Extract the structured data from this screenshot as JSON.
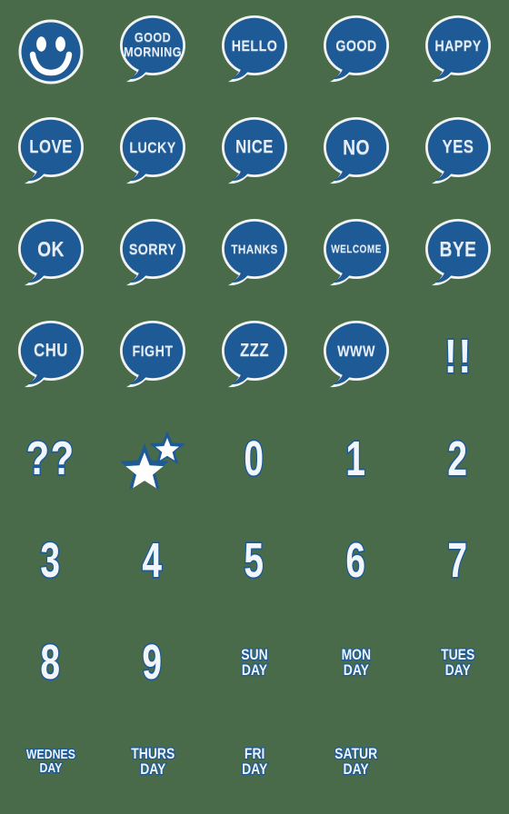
{
  "sheet": {
    "title": "Emoji Sticker Sheet",
    "background_color": "#4a6b4a",
    "bubble_color": "#1d5a96",
    "text_color": "#e8eef5",
    "outline_color": "#1d5a96",
    "columns": 5,
    "rows": 8
  },
  "items": [
    {
      "id": "smiley",
      "kind": "smiley",
      "label": "",
      "name": "sticker-smiley-face",
      "row": 0,
      "col": 0
    },
    {
      "id": "goodmorning",
      "kind": "bubble",
      "label": "GOOD\nMORNING",
      "name": "sticker-good-morning",
      "row": 0,
      "col": 1,
      "size": "sz-two"
    },
    {
      "id": "hello",
      "kind": "bubble",
      "label": "HELLO",
      "name": "sticker-hello",
      "row": 0,
      "col": 2,
      "size": "sz-md"
    },
    {
      "id": "good",
      "kind": "bubble",
      "label": "GOOD",
      "name": "sticker-good",
      "row": 0,
      "col": 3,
      "size": "sz-md"
    },
    {
      "id": "happy",
      "kind": "bubble",
      "label": "HAPPY",
      "name": "sticker-happy",
      "row": 0,
      "col": 4,
      "size": "sz-md"
    },
    {
      "id": "love",
      "kind": "bubble",
      "label": "LOVE",
      "name": "sticker-love",
      "row": 1,
      "col": 0,
      "size": "sz-lg"
    },
    {
      "id": "lucky",
      "kind": "bubble",
      "label": "LUCKY",
      "name": "sticker-lucky",
      "row": 1,
      "col": 1,
      "size": "sz-md"
    },
    {
      "id": "nice",
      "kind": "bubble",
      "label": "NICE",
      "name": "sticker-nice",
      "row": 1,
      "col": 2,
      "size": "sz-lg"
    },
    {
      "id": "no",
      "kind": "bubble",
      "label": "NO",
      "name": "sticker-no",
      "row": 1,
      "col": 3,
      "size": "sz-xl"
    },
    {
      "id": "yes",
      "kind": "bubble",
      "label": "YES",
      "name": "sticker-yes",
      "row": 1,
      "col": 4,
      "size": "sz-lg"
    },
    {
      "id": "ok",
      "kind": "bubble",
      "label": "OK",
      "name": "sticker-ok",
      "row": 2,
      "col": 0,
      "size": "sz-xl"
    },
    {
      "id": "sorry",
      "kind": "bubble",
      "label": "SORRY",
      "name": "sticker-sorry",
      "row": 2,
      "col": 1,
      "size": "sz-md"
    },
    {
      "id": "thanks",
      "kind": "bubble",
      "label": "THANKS",
      "name": "sticker-thanks",
      "row": 2,
      "col": 2,
      "size": "sz-sm"
    },
    {
      "id": "welcome",
      "kind": "bubble",
      "label": "WELCOME",
      "name": "sticker-welcome",
      "row": 2,
      "col": 3,
      "size": "sz-xs"
    },
    {
      "id": "bye",
      "kind": "bubble",
      "label": "BYE",
      "name": "sticker-bye",
      "row": 2,
      "col": 4,
      "size": "sz-xl"
    },
    {
      "id": "chu",
      "kind": "bubble",
      "label": "CHU",
      "name": "sticker-chu",
      "row": 3,
      "col": 0,
      "size": "sz-lg"
    },
    {
      "id": "fight",
      "kind": "bubble",
      "label": "FIGHT",
      "name": "sticker-fight",
      "row": 3,
      "col": 1,
      "size": "sz-md"
    },
    {
      "id": "zzz",
      "kind": "bubble",
      "label": "ZZZ",
      "name": "sticker-zzz",
      "row": 3,
      "col": 2,
      "size": "sz-lg"
    },
    {
      "id": "www",
      "kind": "bubble",
      "label": "WWW",
      "name": "sticker-www",
      "row": 3,
      "col": 3,
      "size": "sz-md"
    },
    {
      "id": "excl",
      "kind": "glyph",
      "label": "!!",
      "name": "sticker-double-exclamation",
      "row": 3,
      "col": 4,
      "glyph_class": "punct"
    },
    {
      "id": "quest",
      "kind": "glyph",
      "label": "??",
      "name": "sticker-double-question",
      "row": 4,
      "col": 0,
      "glyph_class": "punct"
    },
    {
      "id": "stars",
      "kind": "stars",
      "label": "",
      "name": "sticker-two-stars",
      "row": 4,
      "col": 1
    },
    {
      "id": "num0",
      "kind": "glyph",
      "label": "0",
      "name": "sticker-number-0",
      "row": 4,
      "col": 2
    },
    {
      "id": "num1",
      "kind": "glyph",
      "label": "1",
      "name": "sticker-number-1",
      "row": 4,
      "col": 3
    },
    {
      "id": "num2",
      "kind": "glyph",
      "label": "2",
      "name": "sticker-number-2",
      "row": 4,
      "col": 4
    },
    {
      "id": "num3",
      "kind": "glyph",
      "label": "3",
      "name": "sticker-number-3",
      "row": 5,
      "col": 0
    },
    {
      "id": "num4",
      "kind": "glyph",
      "label": "4",
      "name": "sticker-number-4",
      "row": 5,
      "col": 1
    },
    {
      "id": "num5",
      "kind": "glyph",
      "label": "5",
      "name": "sticker-number-5",
      "row": 5,
      "col": 2
    },
    {
      "id": "num6",
      "kind": "glyph",
      "label": "6",
      "name": "sticker-number-6",
      "row": 5,
      "col": 3
    },
    {
      "id": "num7",
      "kind": "glyph",
      "label": "7",
      "name": "sticker-number-7",
      "row": 5,
      "col": 4
    },
    {
      "id": "num8",
      "kind": "glyph",
      "label": "8",
      "name": "sticker-number-8",
      "row": 6,
      "col": 0
    },
    {
      "id": "num9",
      "kind": "glyph",
      "label": "9",
      "name": "sticker-number-9",
      "row": 6,
      "col": 1
    },
    {
      "id": "sunday",
      "kind": "dayword",
      "label": "SUN\nDAY",
      "name": "sticker-sunday",
      "row": 6,
      "col": 2
    },
    {
      "id": "monday",
      "kind": "dayword",
      "label": "MON\nDAY",
      "name": "sticker-monday",
      "row": 6,
      "col": 3
    },
    {
      "id": "tuesday",
      "kind": "dayword",
      "label": "TUES\nDAY",
      "name": "sticker-tuesday",
      "row": 6,
      "col": 4
    },
    {
      "id": "wednesday",
      "kind": "dayword",
      "label": "WEDNES\nDAY",
      "name": "sticker-wednesday",
      "row": 7,
      "col": 0,
      "day_class": "long"
    },
    {
      "id": "thursday",
      "kind": "dayword",
      "label": "THURS\nDAY",
      "name": "sticker-thursday",
      "row": 7,
      "col": 1
    },
    {
      "id": "friday",
      "kind": "dayword",
      "label": "FRI\nDAY",
      "name": "sticker-friday",
      "row": 7,
      "col": 2
    },
    {
      "id": "saturday",
      "kind": "dayword",
      "label": "SATUR\nDAY",
      "name": "sticker-saturday",
      "row": 7,
      "col": 3
    }
  ]
}
